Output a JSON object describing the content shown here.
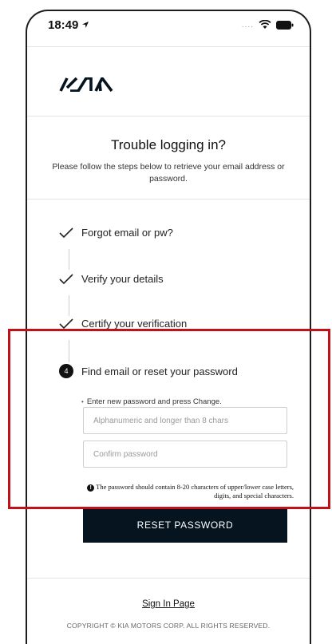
{
  "status_bar": {
    "time": "18:49",
    "signal_dots": "....",
    "location_icon": "location-arrow-icon",
    "wifi_icon": "wifi-icon",
    "battery_icon": "battery-icon"
  },
  "brand": {
    "logo_text": "KIA",
    "brand_color": "#05141f"
  },
  "header": {
    "title": "Trouble logging in?",
    "subtitle": "Please follow the steps below to retrieve your email address or password."
  },
  "steps": [
    {
      "label": "Forgot email or pw?",
      "state": "done"
    },
    {
      "label": "Verify your details",
      "state": "done"
    },
    {
      "label": "Certify your verification",
      "state": "done"
    },
    {
      "label": "Find email or reset your password",
      "state": "current",
      "number": "4"
    }
  ],
  "form": {
    "hint": "Enter new password and press Change.",
    "password_placeholder": "Alphanumeric and longer than 8 chars",
    "confirm_placeholder": "Confirm password",
    "note": "The password should contain 8-20 characters of upper/lower case letters, digits, and special characters.",
    "reset_label": "RESET PASSWORD"
  },
  "footer": {
    "signin_label": "Sign In Page",
    "copyright": "COPYRIGHT © KIA MOTORS CORP. ALL RIGHTS RESERVED."
  },
  "colors": {
    "highlight": "#c1121a",
    "button_bg": "#05141f"
  }
}
